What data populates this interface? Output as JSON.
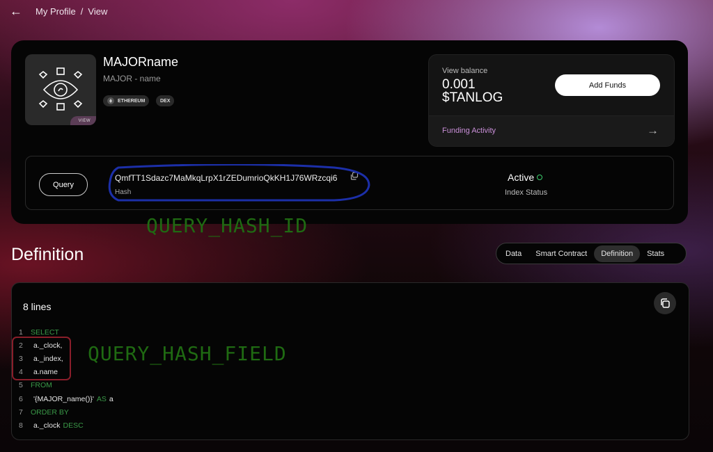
{
  "breadcrumb": {
    "parent": "My Profile",
    "separator": "/",
    "current": "View"
  },
  "profile": {
    "name": "MAJORname",
    "subname": "MAJOR - name",
    "avatar_tag": "VIEW",
    "chips": [
      "ETHEREUM",
      "DEX"
    ]
  },
  "balance": {
    "label": "View balance",
    "amount": "0.001",
    "currency": "$TANLOG",
    "add_funds": "Add Funds",
    "funding_activity": "Funding Activity"
  },
  "query": {
    "button": "Query",
    "hash": "QmfTT1Sdazc7MaMkqLrpX1rZEDumrioQkKH1J76WRzcqi6",
    "hash_label": "Hash",
    "status": "Active",
    "status_label": "Index Status"
  },
  "annotations": {
    "hash_id": "QUERY_HASH_ID",
    "hash_field": "QUERY_HASH_FIELD"
  },
  "section": {
    "title": "Definition"
  },
  "tabs": [
    "Data",
    "Smart Contract",
    "Definition",
    "Stats"
  ],
  "active_tab": "Definition",
  "code": {
    "lines_count": "8 lines",
    "lines": [
      {
        "n": "1",
        "kw": "SELECT",
        "tx": "",
        "kw2": "",
        "tx2": ""
      },
      {
        "n": "2",
        "kw": "",
        "tx": "a._clock,",
        "kw2": "",
        "tx2": ""
      },
      {
        "n": "3",
        "kw": "",
        "tx": "a._index,",
        "kw2": "",
        "tx2": ""
      },
      {
        "n": "4",
        "kw": "",
        "tx": "a.name",
        "kw2": "",
        "tx2": ""
      },
      {
        "n": "5",
        "kw": "FROM",
        "tx": "",
        "kw2": "",
        "tx2": ""
      },
      {
        "n": "6",
        "kw": "",
        "tx": "'{MAJOR_name()}'",
        "kw2": "AS",
        "tx2": "a"
      },
      {
        "n": "7",
        "kw": "ORDER BY",
        "tx": "",
        "kw2": "",
        "tx2": ""
      },
      {
        "n": "8",
        "kw": "",
        "tx": "a._clock",
        "kw2": "DESC",
        "tx2": ""
      }
    ]
  },
  "colors": {
    "keyword": "#3a9a48",
    "accent_purple": "#c98fd8",
    "status_green": "#3ccf6e",
    "annotation_green": "#1f6a12",
    "annotation_blue": "#1c2fa8",
    "annotation_red": "#8a1e2a"
  }
}
